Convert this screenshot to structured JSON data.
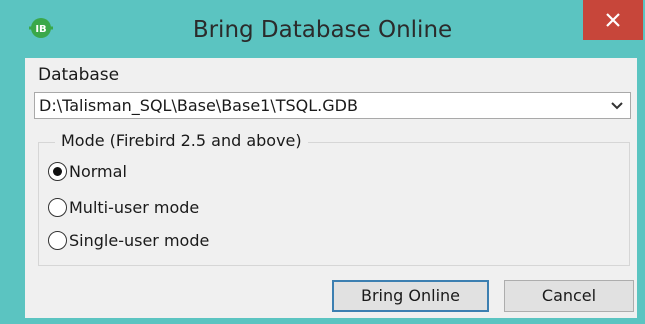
{
  "window": {
    "title": "Bring Database Online",
    "app_icon_text": "IB",
    "app_icon": "interbase-icon",
    "close_icon": "close-icon"
  },
  "database": {
    "label": "Database",
    "value": "D:\\Talisman_SQL\\Base\\Base1\\TSQL.GDB"
  },
  "mode": {
    "legend": "Mode (Firebird 2.5 and above)",
    "options": [
      {
        "label": "Normal",
        "selected": true
      },
      {
        "label": "Multi-user mode",
        "selected": false
      },
      {
        "label": "Single-user mode",
        "selected": false
      }
    ]
  },
  "buttons": {
    "bring_online": "Bring Online",
    "cancel": "Cancel"
  },
  "colors": {
    "titlebar": "#5bc4c1",
    "close": "#c7463a",
    "icon_green": "#3aa84a"
  }
}
